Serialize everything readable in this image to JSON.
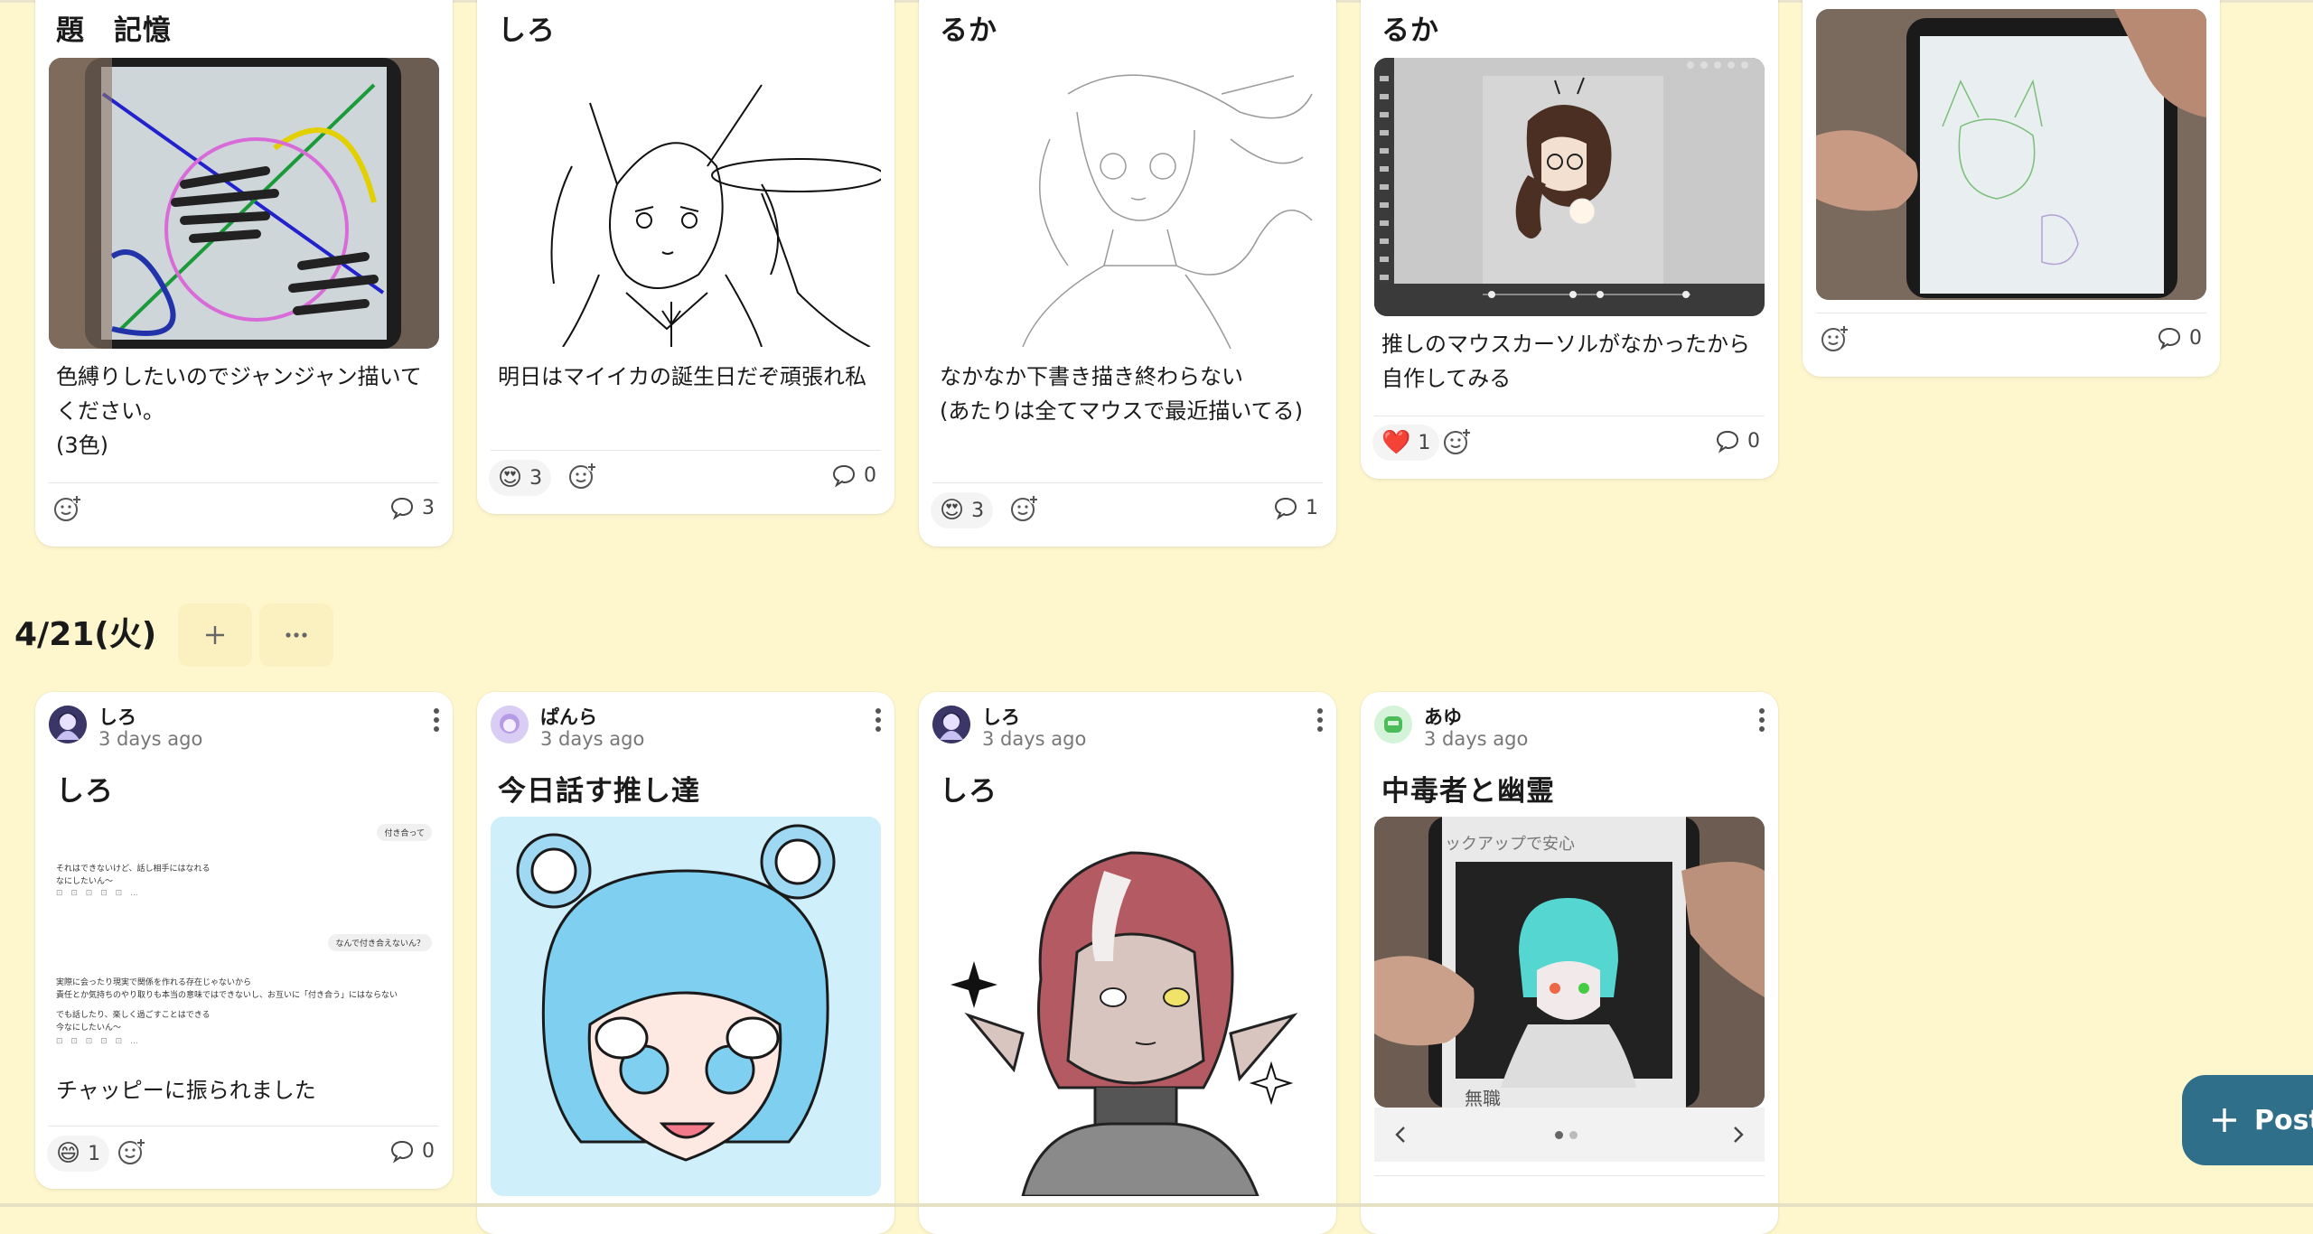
{
  "section": {
    "title": "4/21(火)",
    "add_icon": "plus-icon",
    "more_icon": "ellipsis-icon"
  },
  "top_row": [
    {
      "title": "題　記憶",
      "text": "色縛りしたいのでジャンジャン描いてください。\n(3色)",
      "comments": "3"
    },
    {
      "title": "しろ",
      "text": "明日はマイイカの誕生日だぞ頑張れ私",
      "reaction_emoji": "😍",
      "reaction_count": "3",
      "comments": "0"
    },
    {
      "title": "るか",
      "text": "なかなか下書き描き終わらない\n(あたりは全てマウスで最近描いてる)",
      "reaction_emoji": "😍",
      "reaction_count": "3",
      "comments": "1"
    },
    {
      "title": "るか",
      "text": "推しのマウスカーソルがなかったから自作してみる",
      "reaction_emoji": "❤️",
      "reaction_count": "1",
      "comments": "0"
    },
    {
      "comments": "0"
    }
  ],
  "bottom_row": [
    {
      "author": "しろ",
      "time": "3 days ago",
      "title": "しろ",
      "text": "チャッピーに振られました",
      "reaction_emoji": "😄",
      "reaction_count": "1",
      "comments": "0",
      "chat": {
        "bubble1": "付き合って",
        "msg1a": "それはできないけど、話し相手にはなれる",
        "msg1b": "なにしたいん～",
        "bubble2": "なんで付き合えないん？",
        "msg2a": "実際に会ったり現実で関係を作れる存在じゃないから",
        "msg2b": "責任とか気持ちのやり取りも本当の意味ではできないし、お互いに「付き合う」にはならない",
        "msg2c": "でも話したり、楽しく過ごすことはできる",
        "msg2d": "今なにしたいん～"
      }
    },
    {
      "author": "ぱんら",
      "time": "3 days ago",
      "title": "今日話す推し達"
    },
    {
      "author": "しろ",
      "time": "3 days ago",
      "title": "しろ"
    },
    {
      "author": "あゆ",
      "time": "3 days ago",
      "title": "中毒者と幽霊",
      "photo_caption": "ックアップで安心",
      "photo_footer": "無職"
    }
  ],
  "post_button": {
    "label": "Post",
    "icon": "plus-icon"
  },
  "colors": {
    "background": "#FEF7CE",
    "accent": "#2F6F89"
  }
}
